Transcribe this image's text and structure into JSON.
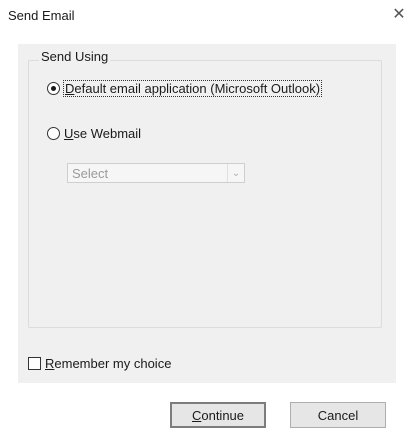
{
  "window": {
    "title": "Send Email",
    "close_glyph": "✕"
  },
  "group": {
    "title": "Send Using"
  },
  "options": [
    {
      "label_accel": "D",
      "label_rest": "efault email application (Microsoft Outlook)",
      "checked": true
    },
    {
      "label_accel": "U",
      "label_rest": "se Webmail",
      "checked": false
    }
  ],
  "webmail_select": {
    "value": "Select",
    "enabled": false
  },
  "remember": {
    "label_accel": "R",
    "label_rest": "emember my choice",
    "checked": false
  },
  "buttons": {
    "continue_accel": "C",
    "continue_rest": "ontinue",
    "cancel": "Cancel"
  }
}
